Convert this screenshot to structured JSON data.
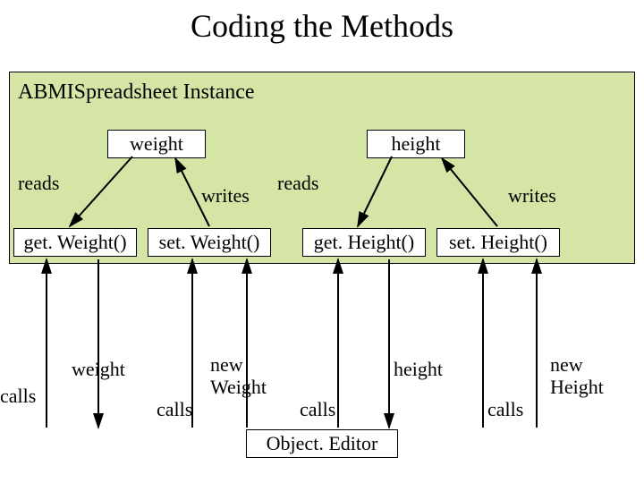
{
  "title": "Coding the Methods",
  "container": "ABMISpreadsheet Instance",
  "vars": {
    "weight": "weight",
    "height": "height"
  },
  "edges": {
    "reads": "reads",
    "writes": "writes"
  },
  "methods": {
    "getWeight": "get. Weight()",
    "setWeight": "set. Weight()",
    "getHeight": "get. Height()",
    "setHeight": "set. Height()"
  },
  "bottom": {
    "calls": "calls",
    "weight": "weight",
    "newWeight_l1": "new",
    "newWeight_l2": "Weight",
    "height": "height",
    "newHeight_l1": "new",
    "newHeight_l2": "Height"
  },
  "editor": "Object. Editor"
}
